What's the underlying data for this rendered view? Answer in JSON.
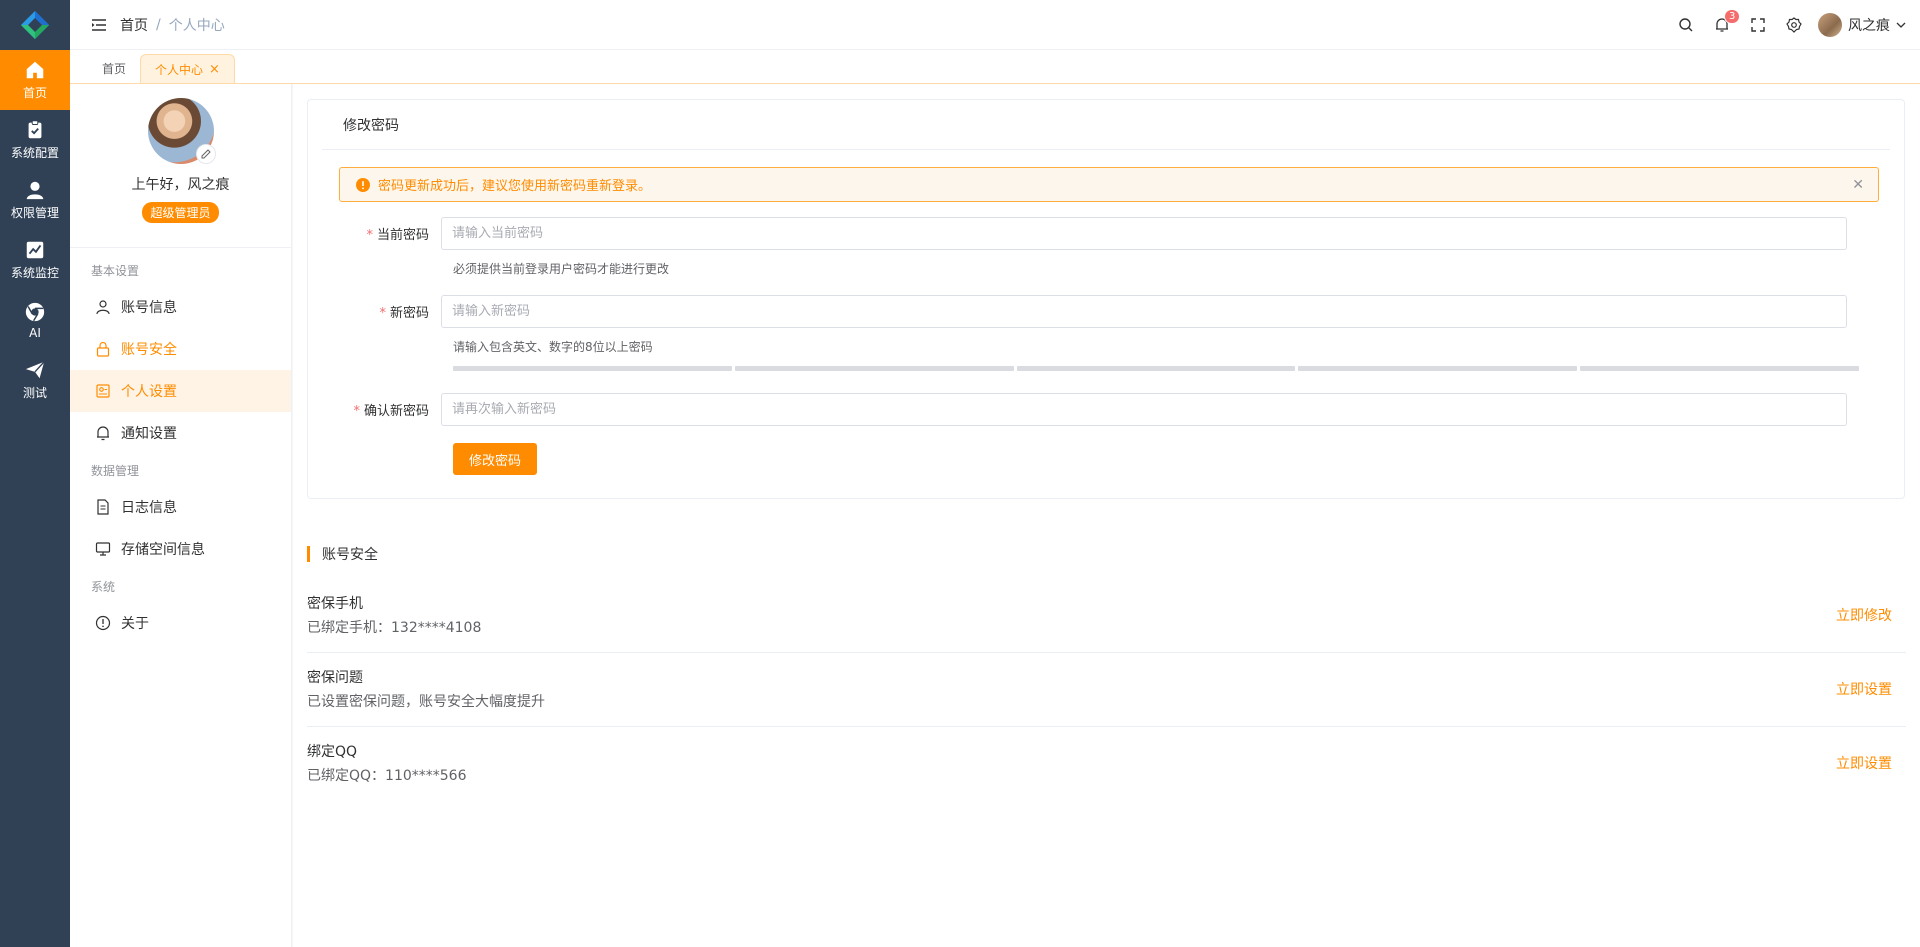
{
  "brand": {
    "accent": "#ff8c00",
    "sidebar_bg": "#304156",
    "badge_red": "#f56c6c"
  },
  "rail": {
    "items": [
      {
        "label": "首页",
        "icon": "home-icon"
      },
      {
        "label": "系统配置",
        "icon": "clipboard-check-icon"
      },
      {
        "label": "权限管理",
        "icon": "user-icon"
      },
      {
        "label": "系统监控",
        "icon": "chart-line-icon"
      },
      {
        "label": "AI",
        "icon": "chrome-icon"
      },
      {
        "label": "测试",
        "icon": "send-icon"
      }
    ]
  },
  "header": {
    "breadcrumb": {
      "home": "首页",
      "separator": "/",
      "current": "个人中心"
    },
    "notification_count": "3",
    "username": "风之痕"
  },
  "tabs": [
    {
      "label": "首页"
    },
    {
      "label": "个人中心",
      "close": "×"
    }
  ],
  "profile": {
    "greeting": "上午好，风之痕",
    "role": "超级管理员"
  },
  "side_menu": {
    "groups": [
      {
        "title": "基本设置",
        "items": [
          {
            "label": "账号信息",
            "icon": "user-outline-icon"
          },
          {
            "label": "账号安全",
            "icon": "lock-icon"
          },
          {
            "label": "个人设置",
            "icon": "profile-card-icon"
          },
          {
            "label": "通知设置",
            "icon": "bell-icon"
          }
        ]
      },
      {
        "title": "数据管理",
        "items": [
          {
            "label": "日志信息",
            "icon": "document-icon"
          },
          {
            "label": "存储空间信息",
            "icon": "monitor-icon"
          }
        ]
      },
      {
        "title": "系统",
        "items": [
          {
            "label": "关于",
            "icon": "info-circle-icon"
          }
        ]
      }
    ]
  },
  "password_card": {
    "title": "修改密码",
    "alert": "密码更新成功后，建议您使用新密码重新登录。",
    "fields": {
      "current": {
        "label": "当前密码",
        "placeholder": "请输入当前密码",
        "hint": "必须提供当前登录用户密码才能进行更改",
        "required": "*"
      },
      "new": {
        "label": "新密码",
        "placeholder": "请输入新密码",
        "hint": "请输入包含英文、数字的8位以上密码",
        "required": "*"
      },
      "confirm": {
        "label": "确认新密码",
        "placeholder": "请再次输入新密码",
        "required": "*"
      }
    },
    "submit": "修改密码"
  },
  "security_section": {
    "title": "账号安全",
    "rows": [
      {
        "title": "密保手机",
        "desc": "已绑定手机：132****4108",
        "action": "立即修改"
      },
      {
        "title": "密保问题",
        "desc": "已设置密保问题，账号安全大幅度提升",
        "action": "立即设置"
      },
      {
        "title": "绑定QQ",
        "desc": "已绑定QQ：110****566",
        "action": "立即设置"
      }
    ]
  }
}
